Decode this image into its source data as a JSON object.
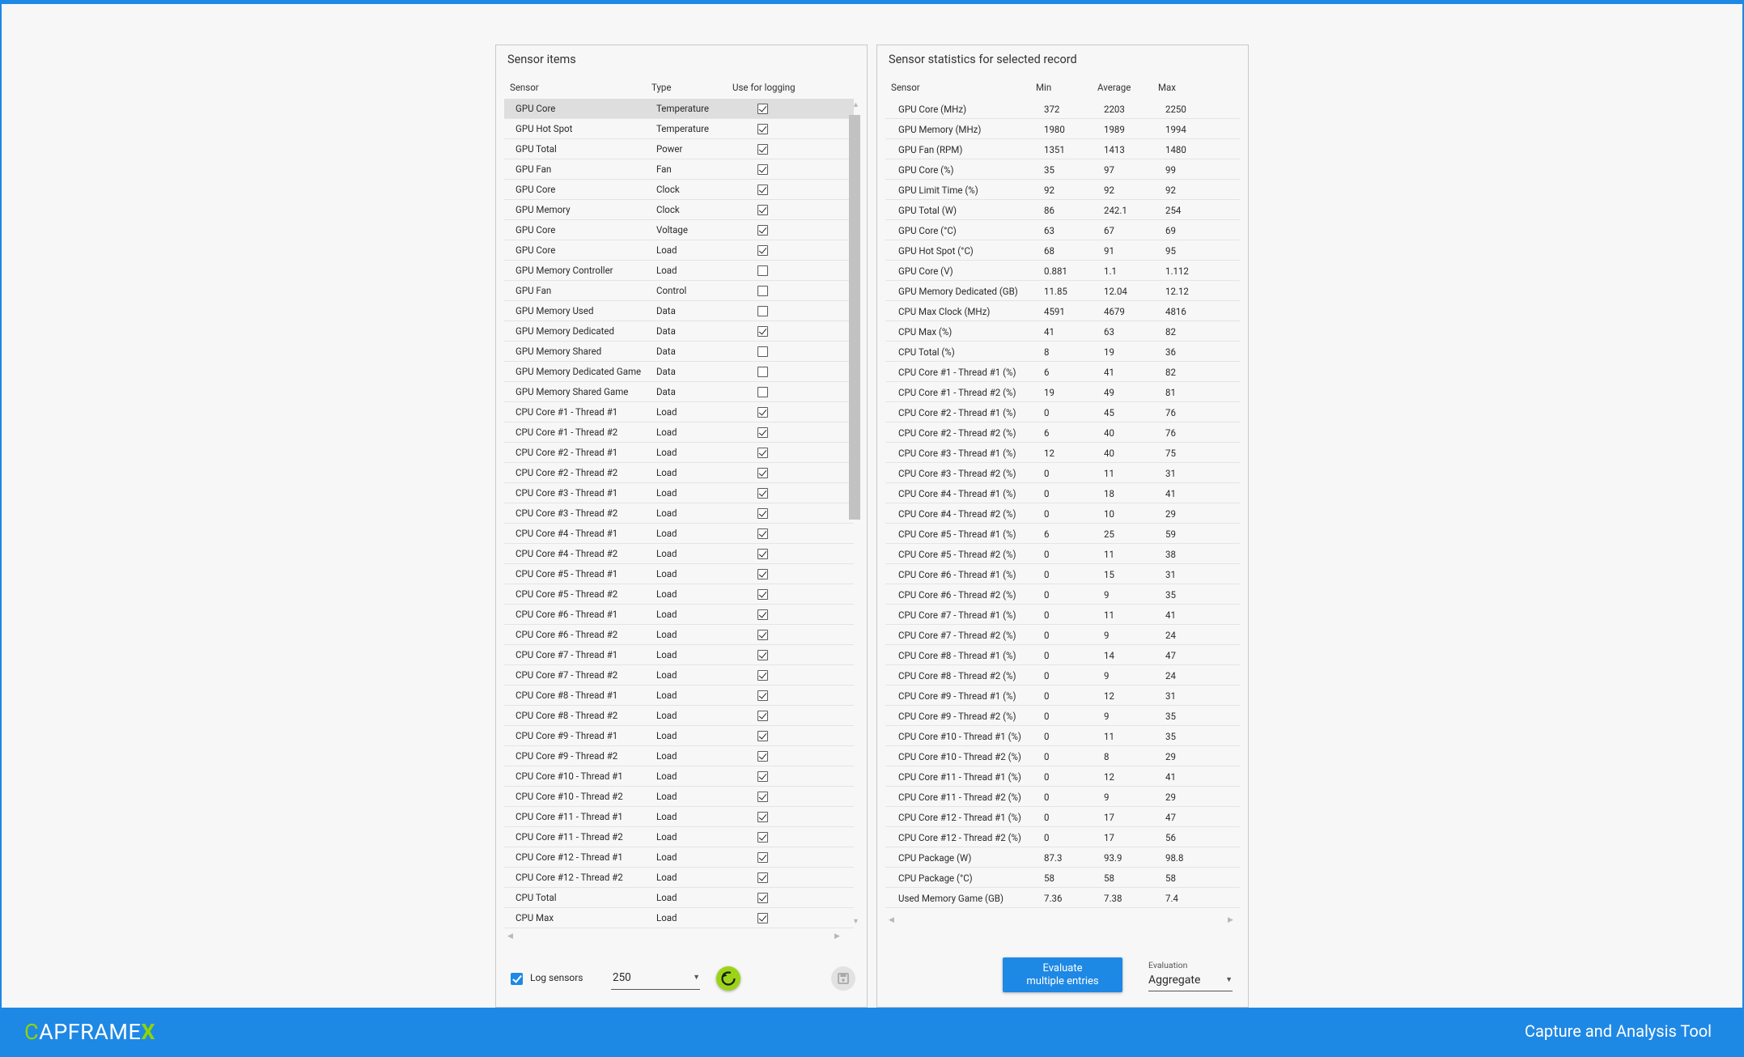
{
  "sensor_panel": {
    "title": "Sensor items",
    "columns": {
      "sensor": "Sensor",
      "type": "Type",
      "use": "Use for logging"
    },
    "rows": [
      {
        "name": "GPU Core",
        "type": "Temperature",
        "checked": true
      },
      {
        "name": "GPU Hot Spot",
        "type": "Temperature",
        "checked": true
      },
      {
        "name": "GPU Total",
        "type": "Power",
        "checked": true
      },
      {
        "name": "GPU Fan",
        "type": "Fan",
        "checked": true
      },
      {
        "name": "GPU Core",
        "type": "Clock",
        "checked": true
      },
      {
        "name": "GPU Memory",
        "type": "Clock",
        "checked": true
      },
      {
        "name": "GPU Core",
        "type": "Voltage",
        "checked": true
      },
      {
        "name": "GPU Core",
        "type": "Load",
        "checked": true
      },
      {
        "name": "GPU Memory Controller",
        "type": "Load",
        "checked": false
      },
      {
        "name": "GPU Fan",
        "type": "Control",
        "checked": false
      },
      {
        "name": "GPU Memory Used",
        "type": "Data",
        "checked": false
      },
      {
        "name": "GPU Memory Dedicated",
        "type": "Data",
        "checked": true
      },
      {
        "name": "GPU Memory Shared",
        "type": "Data",
        "checked": false
      },
      {
        "name": "GPU Memory Dedicated Game",
        "type": "Data",
        "checked": false
      },
      {
        "name": "GPU Memory Shared Game",
        "type": "Data",
        "checked": false
      },
      {
        "name": "CPU Core #1 - Thread #1",
        "type": "Load",
        "checked": true
      },
      {
        "name": "CPU Core #1 - Thread #2",
        "type": "Load",
        "checked": true
      },
      {
        "name": "CPU Core #2 - Thread #1",
        "type": "Load",
        "checked": true
      },
      {
        "name": "CPU Core #2 - Thread #2",
        "type": "Load",
        "checked": true
      },
      {
        "name": "CPU Core #3 - Thread #1",
        "type": "Load",
        "checked": true
      },
      {
        "name": "CPU Core #3 - Thread #2",
        "type": "Load",
        "checked": true
      },
      {
        "name": "CPU Core #4 - Thread #1",
        "type": "Load",
        "checked": true
      },
      {
        "name": "CPU Core #4 - Thread #2",
        "type": "Load",
        "checked": true
      },
      {
        "name": "CPU Core #5 - Thread #1",
        "type": "Load",
        "checked": true
      },
      {
        "name": "CPU Core #5 - Thread #2",
        "type": "Load",
        "checked": true
      },
      {
        "name": "CPU Core #6 - Thread #1",
        "type": "Load",
        "checked": true
      },
      {
        "name": "CPU Core #6 - Thread #2",
        "type": "Load",
        "checked": true
      },
      {
        "name": "CPU Core #7 - Thread #1",
        "type": "Load",
        "checked": true
      },
      {
        "name": "CPU Core #7 - Thread #2",
        "type": "Load",
        "checked": true
      },
      {
        "name": "CPU Core #8 - Thread #1",
        "type": "Load",
        "checked": true
      },
      {
        "name": "CPU Core #8 - Thread #2",
        "type": "Load",
        "checked": true
      },
      {
        "name": "CPU Core #9 - Thread #1",
        "type": "Load",
        "checked": true
      },
      {
        "name": "CPU Core #9 - Thread #2",
        "type": "Load",
        "checked": true
      },
      {
        "name": "CPU Core #10 - Thread #1",
        "type": "Load",
        "checked": true
      },
      {
        "name": "CPU Core #10 - Thread #2",
        "type": "Load",
        "checked": true
      },
      {
        "name": "CPU Core #11 - Thread #1",
        "type": "Load",
        "checked": true
      },
      {
        "name": "CPU Core #11 - Thread #2",
        "type": "Load",
        "checked": true
      },
      {
        "name": "CPU Core #12 - Thread #1",
        "type": "Load",
        "checked": true
      },
      {
        "name": "CPU Core #12 - Thread #2",
        "type": "Load",
        "checked": true
      },
      {
        "name": "CPU Total",
        "type": "Load",
        "checked": true
      },
      {
        "name": "CPU Max",
        "type": "Load",
        "checked": true
      }
    ],
    "log_sensors_label": "Log sensors",
    "log_sensors_checked": true,
    "interval_value": "250"
  },
  "stats_panel": {
    "title": "Sensor statistics for selected record",
    "columns": {
      "sensor": "Sensor",
      "min": "Min",
      "avg": "Average",
      "max": "Max"
    },
    "rows": [
      {
        "name": "GPU Core (MHz)",
        "min": "372",
        "avg": "2203",
        "max": "2250"
      },
      {
        "name": "GPU Memory (MHz)",
        "min": "1980",
        "avg": "1989",
        "max": "1994"
      },
      {
        "name": "GPU Fan (RPM)",
        "min": "1351",
        "avg": "1413",
        "max": "1480"
      },
      {
        "name": "GPU Core (%)",
        "min": "35",
        "avg": "97",
        "max": "99"
      },
      {
        "name": "GPU Limit Time (%)",
        "min": "92",
        "avg": "92",
        "max": "92"
      },
      {
        "name": "GPU Total (W)",
        "min": "86",
        "avg": "242.1",
        "max": "254"
      },
      {
        "name": "GPU Core (°C)",
        "min": "63",
        "avg": "67",
        "max": "69"
      },
      {
        "name": "GPU Hot Spot (°C)",
        "min": "68",
        "avg": "91",
        "max": "95"
      },
      {
        "name": "GPU Core (V)",
        "min": "0.881",
        "avg": "1.1",
        "max": "1.112"
      },
      {
        "name": "GPU Memory Dedicated (GB)",
        "min": "11.85",
        "avg": "12.04",
        "max": "12.12"
      },
      {
        "name": "CPU Max Clock (MHz)",
        "min": "4591",
        "avg": "4679",
        "max": "4816"
      },
      {
        "name": "CPU Max (%)",
        "min": "41",
        "avg": "63",
        "max": "82"
      },
      {
        "name": "CPU Total (%)",
        "min": "8",
        "avg": "19",
        "max": "36"
      },
      {
        "name": "CPU Core #1 - Thread #1 (%)",
        "min": "6",
        "avg": "41",
        "max": "82"
      },
      {
        "name": "CPU Core #1 - Thread #2 (%)",
        "min": "19",
        "avg": "49",
        "max": "81"
      },
      {
        "name": "CPU Core #2 - Thread #1 (%)",
        "min": "0",
        "avg": "45",
        "max": "76"
      },
      {
        "name": "CPU Core #2 - Thread #2 (%)",
        "min": "6",
        "avg": "40",
        "max": "76"
      },
      {
        "name": "CPU Core #3 - Thread #1 (%)",
        "min": "12",
        "avg": "40",
        "max": "75"
      },
      {
        "name": "CPU Core #3 - Thread #2 (%)",
        "min": "0",
        "avg": "11",
        "max": "31"
      },
      {
        "name": "CPU Core #4 - Thread #1 (%)",
        "min": "0",
        "avg": "18",
        "max": "41"
      },
      {
        "name": "CPU Core #4 - Thread #2 (%)",
        "min": "0",
        "avg": "10",
        "max": "29"
      },
      {
        "name": "CPU Core #5 - Thread #1 (%)",
        "min": "6",
        "avg": "25",
        "max": "59"
      },
      {
        "name": "CPU Core #5 - Thread #2 (%)",
        "min": "0",
        "avg": "11",
        "max": "38"
      },
      {
        "name": "CPU Core #6 - Thread #1 (%)",
        "min": "0",
        "avg": "15",
        "max": "31"
      },
      {
        "name": "CPU Core #6 - Thread #2 (%)",
        "min": "0",
        "avg": "9",
        "max": "35"
      },
      {
        "name": "CPU Core #7 - Thread #1 (%)",
        "min": "0",
        "avg": "11",
        "max": "41"
      },
      {
        "name": "CPU Core #7 - Thread #2 (%)",
        "min": "0",
        "avg": "9",
        "max": "24"
      },
      {
        "name": "CPU Core #8 - Thread #1 (%)",
        "min": "0",
        "avg": "14",
        "max": "47"
      },
      {
        "name": "CPU Core #8 - Thread #2 (%)",
        "min": "0",
        "avg": "9",
        "max": "24"
      },
      {
        "name": "CPU Core #9 - Thread #1 (%)",
        "min": "0",
        "avg": "12",
        "max": "31"
      },
      {
        "name": "CPU Core #9 - Thread #2 (%)",
        "min": "0",
        "avg": "9",
        "max": "35"
      },
      {
        "name": "CPU Core #10 - Thread #1 (%)",
        "min": "0",
        "avg": "11",
        "max": "35"
      },
      {
        "name": "CPU Core #10 - Thread #2 (%)",
        "min": "0",
        "avg": "8",
        "max": "29"
      },
      {
        "name": "CPU Core #11 - Thread #1 (%)",
        "min": "0",
        "avg": "12",
        "max": "41"
      },
      {
        "name": "CPU Core #11 - Thread #2 (%)",
        "min": "0",
        "avg": "9",
        "max": "29"
      },
      {
        "name": "CPU Core #12 - Thread #1 (%)",
        "min": "0",
        "avg": "17",
        "max": "47"
      },
      {
        "name": "CPU Core #12 - Thread #2 (%)",
        "min": "0",
        "avg": "17",
        "max": "56"
      },
      {
        "name": "CPU Package (W)",
        "min": "87.3",
        "avg": "93.9",
        "max": "98.8"
      },
      {
        "name": "CPU Package (°C)",
        "min": "58",
        "avg": "58",
        "max": "58"
      },
      {
        "name": "Used Memory Game (GB)",
        "min": "7.36",
        "avg": "7.38",
        "max": "7.4"
      }
    ],
    "evaluate_button": [
      "Evaluate",
      "multiple entries"
    ],
    "evaluation_label": "Evaluation",
    "evaluation_value": "Aggregate"
  },
  "footer": {
    "logo_c": "C",
    "logo_mid": "APFRAME",
    "logo_x": "X",
    "subtitle": "Capture and Analysis Tool"
  },
  "colors": {
    "accent": "#1e88e5",
    "logo_green": "#8ed400",
    "refresh_green": "#9bd417"
  }
}
